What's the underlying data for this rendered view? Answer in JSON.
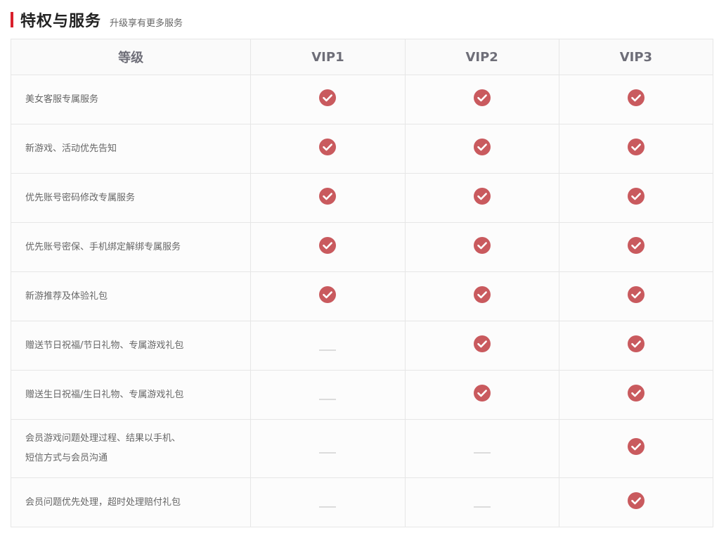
{
  "header": {
    "title": "特权与服务",
    "subtitle": "升级享有更多服务"
  },
  "colors": {
    "accent": "#d9202c",
    "check": "#c95a5e"
  },
  "table": {
    "columns": [
      "等级",
      "VIP1",
      "VIP2",
      "VIP3"
    ],
    "rows": [
      {
        "feature": "美女客服专属服务",
        "vip": [
          "check",
          "check",
          "check"
        ]
      },
      {
        "feature": "新游戏、活动优先告知",
        "vip": [
          "check",
          "check",
          "check"
        ]
      },
      {
        "feature": "优先账号密码修改专属服务",
        "vip": [
          "check",
          "check",
          "check"
        ]
      },
      {
        "feature": "优先账号密保、手机绑定解绑专属服务",
        "vip": [
          "check",
          "check",
          "check"
        ]
      },
      {
        "feature": "新游推荐及体验礼包",
        "vip": [
          "check",
          "check",
          "check"
        ]
      },
      {
        "feature": "赠送节日祝福/节日礼物、专属游戏礼包",
        "vip": [
          "none",
          "check",
          "check"
        ]
      },
      {
        "feature": "赠送生日祝福/生日礼物、专属游戏礼包",
        "vip": [
          "none",
          "check",
          "check"
        ]
      },
      {
        "feature": [
          "会员游戏问题处理过程、结果以手机、",
          "短信方式与会员沟通"
        ],
        "vip": [
          "none",
          "none",
          "check"
        ]
      },
      {
        "feature": "会员问题优先处理，超时处理赔付礼包",
        "vip": [
          "none",
          "none",
          "check"
        ]
      }
    ]
  }
}
